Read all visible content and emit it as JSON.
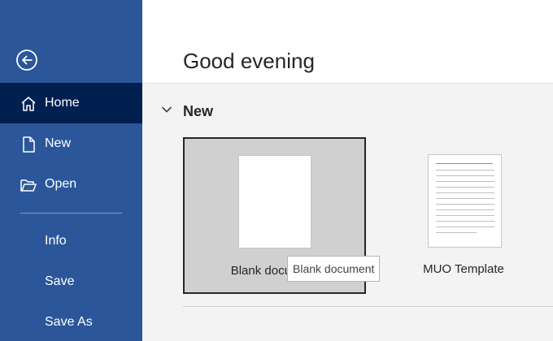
{
  "sidebar": {
    "background": "#2b579a",
    "active_background": "#002050",
    "back_icon": "back-arrow-icon",
    "items": [
      {
        "label": "Home",
        "icon": "home-icon",
        "active": true
      },
      {
        "label": "New",
        "icon": "new-document-icon",
        "active": false
      },
      {
        "label": "Open",
        "icon": "folder-open-icon",
        "active": false
      },
      {
        "label": "Info",
        "active": false
      },
      {
        "label": "Save",
        "active": false
      },
      {
        "label": "Save As",
        "active": false
      }
    ]
  },
  "main": {
    "greeting": "Good evening",
    "section": {
      "title": "New",
      "toggle_icon": "chevron-down-icon"
    },
    "templates": [
      {
        "label": "Blank document",
        "selected": true
      },
      {
        "label": "MUO Template",
        "selected": false
      }
    ],
    "tooltip": "Blank document"
  }
}
